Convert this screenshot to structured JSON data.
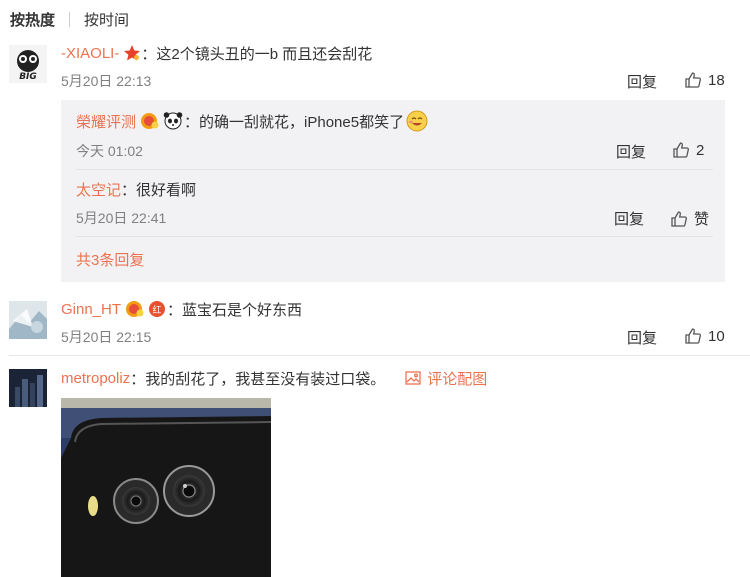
{
  "sort": {
    "active": "按热度",
    "other": "按时间"
  },
  "comments": [
    {
      "user": "-XIAOLI-",
      "text": "：这2个镜头丑的一b 而且还会刮花",
      "time": "5月20日 22:13",
      "reply_label": "回复",
      "likes": "18"
    },
    {
      "user": "Ginn_HT",
      "text": "：蓝宝石是个好东西",
      "time": "5月20日 22:15",
      "reply_label": "回复",
      "likes": "10"
    },
    {
      "user": "metropoliz",
      "text": "：我的刮花了，我甚至没有装过口袋。",
      "image_link": "评论配图"
    }
  ],
  "replies": [
    {
      "user": "榮耀评测",
      "text": "：的确一刮就花，iPhone5都笑了",
      "time": "今天 01:02",
      "reply_label": "回复",
      "likes": "2"
    },
    {
      "user": "太空记",
      "text": "：很好看啊",
      "time": "5月20日 22:41",
      "reply_label": "回复",
      "likes": "赞"
    }
  ],
  "more_replies": "共3条回复",
  "colors": {
    "username": "#eb7350",
    "reply_bg": "#f2f2f5",
    "meta": "#808080"
  },
  "icons": [
    "thumbs-up-icon",
    "image-icon",
    "star-badge-icon",
    "verified-badge-icon"
  ]
}
